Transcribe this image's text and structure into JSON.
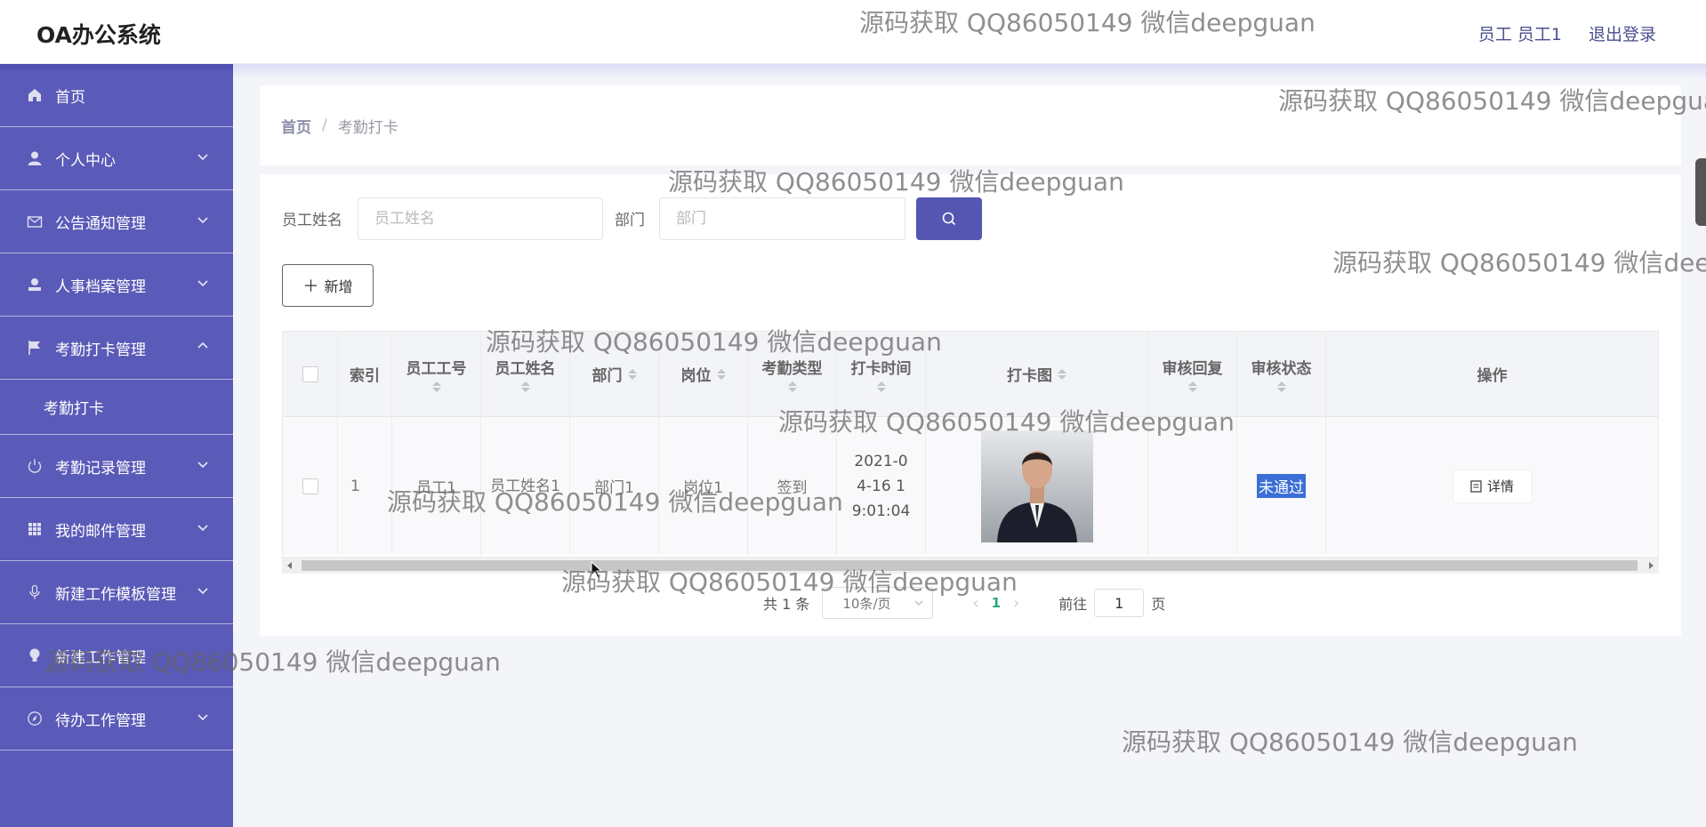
{
  "header": {
    "title": "OA办公系统",
    "user": "员工 员工1",
    "logout": "退出登录"
  },
  "sidebar": {
    "items": [
      {
        "label": "首页",
        "icon": "home-icon"
      },
      {
        "label": "个人中心",
        "icon": "user-icon"
      },
      {
        "label": "公告通知管理",
        "icon": "mail-icon"
      },
      {
        "label": "人事档案管理",
        "icon": "user-card-icon"
      },
      {
        "label": "考勤打卡管理",
        "icon": "flag-icon"
      },
      {
        "label": "考勤打卡",
        "icon": ""
      },
      {
        "label": "考勤记录管理",
        "icon": "power-icon"
      },
      {
        "label": "我的邮件管理",
        "icon": "grid-icon"
      },
      {
        "label": "新建工作模板管理",
        "icon": "mic-icon"
      },
      {
        "label": "新建工作管理",
        "icon": "bulb-icon"
      },
      {
        "label": "待办工作管理",
        "icon": "compass-icon"
      }
    ]
  },
  "breadcrumb": {
    "home": "首页",
    "separator": "/",
    "current": "考勤打卡"
  },
  "search": {
    "name_label": "员工姓名",
    "name_placeholder": "员工姓名",
    "dept_label": "部门",
    "dept_placeholder": "部门"
  },
  "toolbar": {
    "add_label": "新增"
  },
  "table": {
    "headers": {
      "index": "索引",
      "emp_no": "员工工号",
      "emp_name": "员工姓名",
      "dept": "部门",
      "post": "岗位",
      "type": "考勤类型",
      "time": "打卡时间",
      "photo": "打卡图",
      "reply": "审核回复",
      "status": "审核状态",
      "actions": "操作"
    },
    "rows": [
      {
        "index": "1",
        "emp_no": "员工1",
        "emp_name": "员工姓名1",
        "dept": "部门1",
        "post": "岗位1",
        "type": "签到",
        "time": "2021-04-16 19:01:04",
        "reply": "",
        "status": "未通过",
        "detail": "详情"
      }
    ]
  },
  "pagination": {
    "total": "共 1 条",
    "page_size": "10条/页",
    "current_page": "1",
    "goto_label": "前往",
    "goto_value": "1",
    "page_suffix": "页"
  },
  "watermark": "源码获取 QQ86050149 微信deepguan",
  "colors": {
    "sidebar": "#5a5ab8",
    "primary_button": "#5456b2",
    "active_page": "#2aa876",
    "status_badge": "#3b6fd6"
  }
}
